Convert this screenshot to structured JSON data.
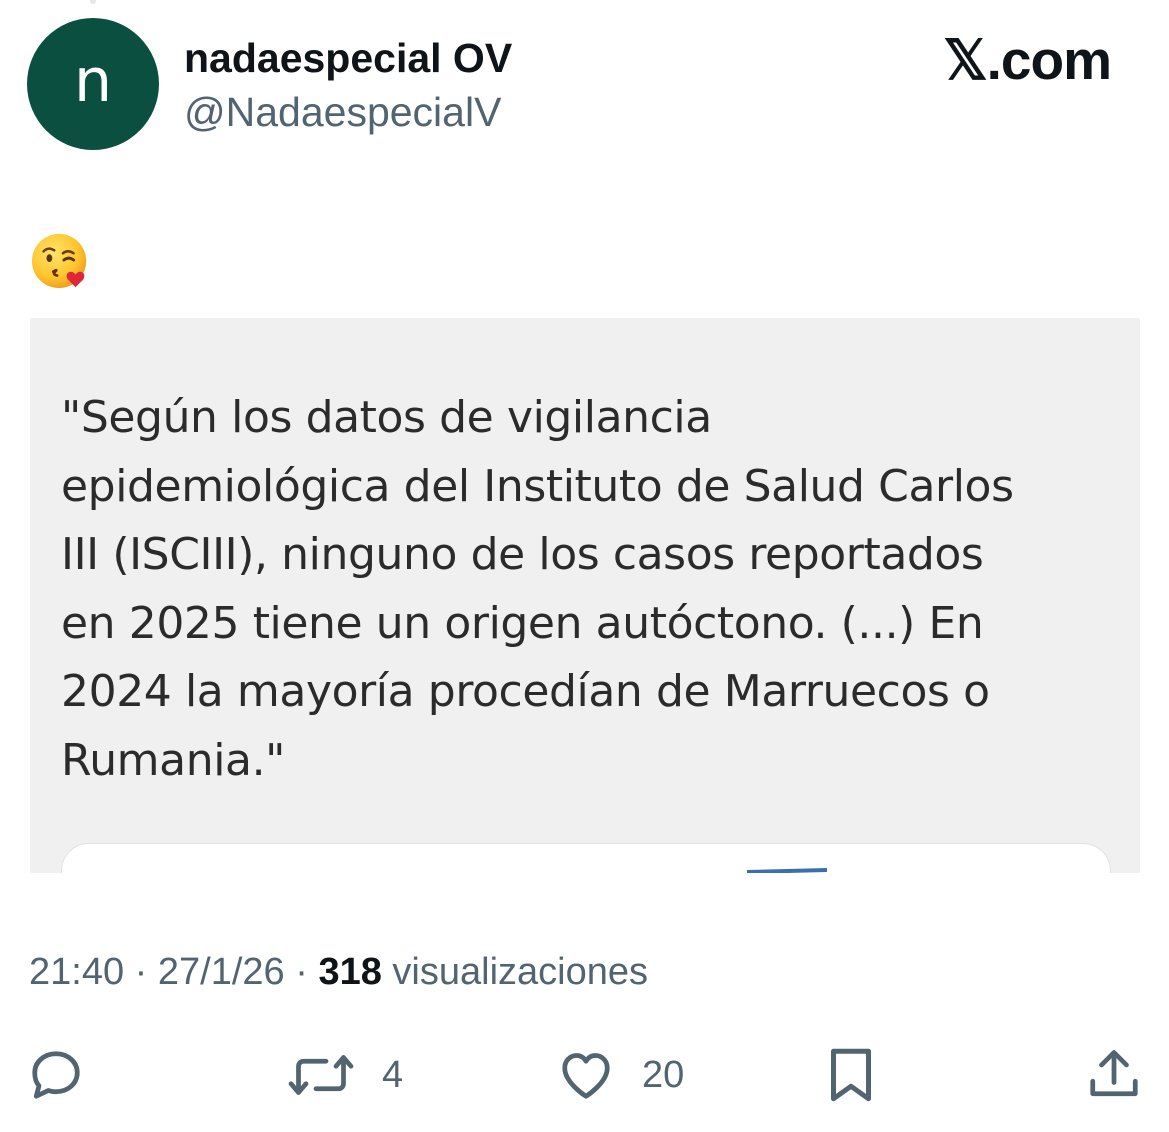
{
  "author": {
    "avatar_letter": "n",
    "avatar_color": "#0b4f40",
    "display_name": "nadaespecial OV",
    "handle": "@NadaespecialV"
  },
  "site_label": "𝕏.com",
  "tweet": {
    "emoji": "kissing-face-with-heart-emoji",
    "quote_text": "\"Según los datos de vigilancia\nepidemiológica del Instituto de Salud Carlos\nIII (ISCIII), ninguno de los casos reportados\nen 2025 tiene un origen autóctono. (...) En\n2024 la mayoría procedían de Marruecos o\nRumania.\""
  },
  "meta": {
    "time": "21:40",
    "date": "27/1/26",
    "views_count": "318",
    "views_label": "visualizaciones"
  },
  "actions": {
    "reply": {
      "icon": "reply-icon",
      "count": ""
    },
    "repost": {
      "icon": "repost-icon",
      "count": "4"
    },
    "like": {
      "icon": "heart-icon",
      "count": "20"
    },
    "bookmark": {
      "icon": "bookmark-icon",
      "count": ""
    },
    "share": {
      "icon": "share-icon",
      "count": ""
    }
  },
  "colors": {
    "text_primary": "#0f1419",
    "text_secondary": "#536471",
    "image_background": "#f0f0f0"
  }
}
